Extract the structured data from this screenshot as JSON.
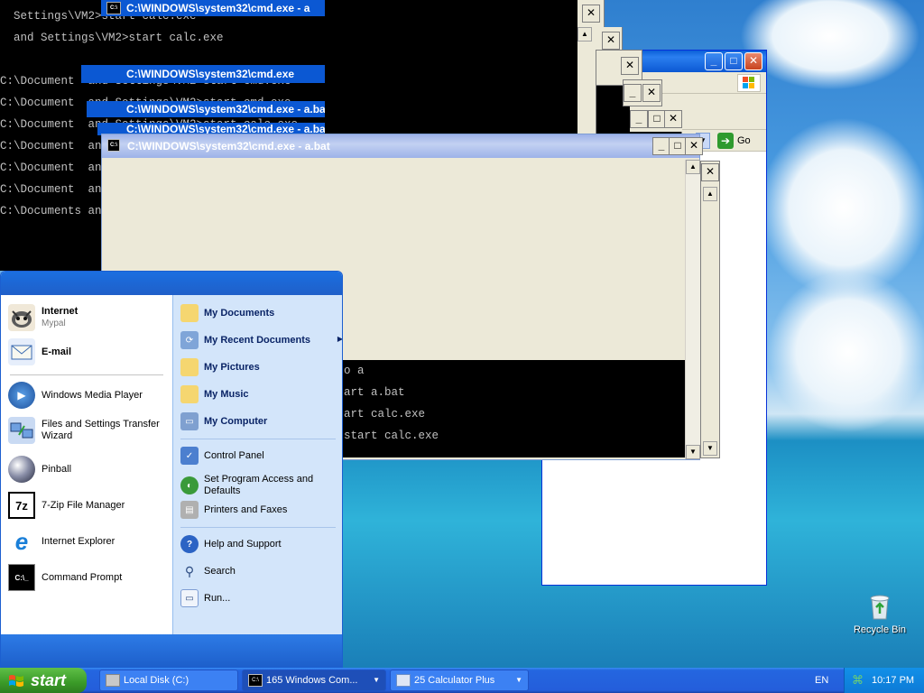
{
  "console_back": {
    "title": "C:\\WINDOWS\\system32\\cmd.exe - a",
    "lines": [
      "  Settings\\VM2>start calc.exe",
      "  and Settings\\VM2>start calc.exe",
      "",
      "C:\\Document  and Settings\\VM2>start cmd.exe",
      "C:\\Document  and Settings\\VM2>start cmd.exe",
      "C:\\Document  and Settings\\VM2>start calc.exe",
      "C:\\Document  and Settings\\VM2>start cmd.exe",
      "C:\\Document  and Settings\\VM2>goto a",
      "C:\\Document  and Settings\\VM2>start a.bat",
      "C:\\Documents and Settings\\VM2>start cmd.exe"
    ]
  },
  "stacked_titles": [
    "C:\\WINDOWS\\system32\\cmd.exe",
    "C:\\WINDOWS\\system32\\cmd.exe - a.bat",
    "C:\\WINDOWS\\system32\\cmd.exe - a.bat"
  ],
  "console_front": {
    "title": "C:\\WINDOWS\\system32\\cmd.exe - a.bat",
    "lines": [
      "o a",
      "art a.bat",
      "art calc.exe",
      "start calc.exe"
    ]
  },
  "explorer": {
    "go_label": "Go"
  },
  "start_menu": {
    "pinned": [
      {
        "label": "Internet",
        "sub": "Mypal"
      },
      {
        "label": "E-mail"
      }
    ],
    "recent": [
      "Windows Media Player",
      "Files and Settings Transfer Wizard",
      "Pinball",
      "7-Zip File Manager",
      "Internet Explorer",
      "Command Prompt"
    ],
    "places": [
      "My Documents",
      "My Recent Documents",
      "My Pictures",
      "My Music",
      "My Computer"
    ],
    "system": [
      "Control Panel",
      "Set Program Access and Defaults",
      "Printers and Faxes"
    ],
    "help": [
      "Help and Support",
      "Search",
      "Run..."
    ],
    "icon_text": {
      "seven_zip": "7z",
      "cmd": "C:\\_",
      "console": "C:\\"
    }
  },
  "desktop": {
    "recycle_bin": "Recycle Bin"
  },
  "taskbar": {
    "start": "start",
    "tasks": [
      {
        "label": "Local Disk (C:)"
      },
      {
        "label": "165 Windows Com..."
      },
      {
        "label": "25 Calculator Plus"
      }
    ],
    "language": "EN",
    "clock": "10:17 PM"
  },
  "colors": {
    "titlebar_blue": "#0b58d3",
    "start_green": "#3a9a28",
    "taskbar_blue": "#245edb"
  }
}
